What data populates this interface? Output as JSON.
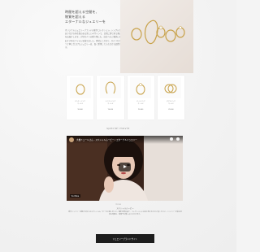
{
  "hero": {
    "title": "時間を超える空間を、\n物質を超える\nエターナルなジュエリーを",
    "body": "オリジナルジュエリーブランドの新作コレクション。シンプルでありながら存在感のある美しいデザインで、日常に寄り添う輝きをお届けします。大切な人への贈り物にも、自分へのご褒美にもおすすめのアイテムを揃えました。素材にこだわり、ひとつひとつ丁寧に仕上げたジュエリーは、長く愛用していただける品質です。",
    "image_alt": "rings"
  },
  "products": [
    {
      "name": "ピンキーリング\nゴールド",
      "price": "¥0,000"
    },
    {
      "name": "ツイストリング\nゴールド",
      "price": "¥0,000"
    },
    {
      "name": "パールリング\nゴールド",
      "price": "¥0,000"
    },
    {
      "name": "ダブルリング\nゴールド",
      "price": "¥0,000"
    }
  ],
  "section_title": "special movie",
  "video": {
    "title": "大橋ミュールさん - スペシャルムービー / エターナルジュエリー",
    "platform_label": "YouTube",
    "caption": "movie"
  },
  "description": {
    "title": "スペシャルムービー",
    "body": "新作ジュエリーの魅力を伝えるスペシャルムービーを公開しました。撮影の舞台裏や、コレクションに込めた想いをぜひご覧ください。ジュエリーが彩る特別な時間を、映像でお楽しみいただけます。"
  },
  "cta": {
    "label": "ジュエリーブランドサイト"
  }
}
